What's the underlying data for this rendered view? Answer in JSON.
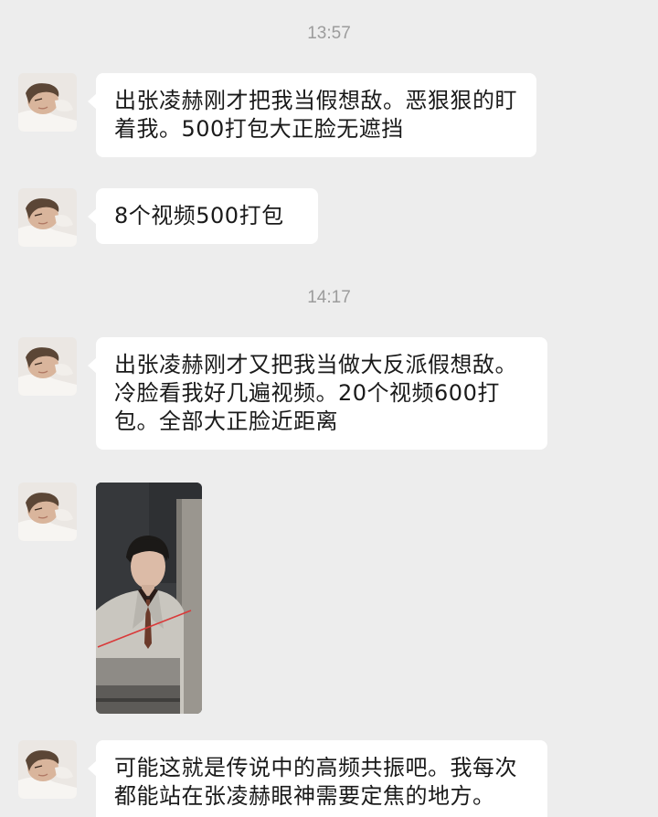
{
  "timestamps": [
    "13:57",
    "14:17"
  ],
  "messages": [
    {
      "text": "出张凌赫刚才把我当假想敌。恶狠狠的盯着我。500打包大正脸无遮挡"
    },
    {
      "text": "8个视频500打包"
    },
    {
      "text": "出张凌赫刚才又把我当做大反派假想敌。冷脸看我好几遍视频。20个视频600打包。全部大正脸近距离"
    },
    {
      "text": "可能这就是传说中的高频共振吧。我每次都能站在张凌赫眼神需要定焦的地方。"
    }
  ],
  "colors": {
    "background": "#ededed",
    "bubble": "#ffffff",
    "timestamp": "#9c9c9c"
  }
}
